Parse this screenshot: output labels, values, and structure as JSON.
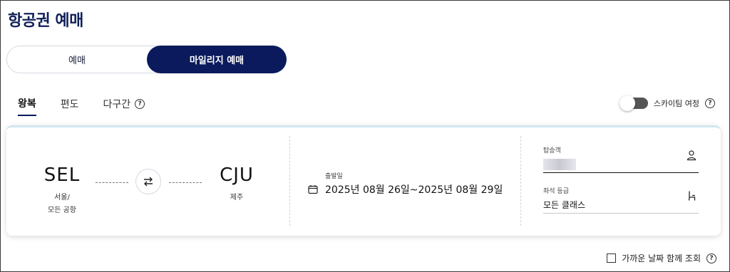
{
  "page": {
    "title": "항공권 예매"
  },
  "booking_mode": {
    "options": [
      "예매",
      "마일리지 예매"
    ],
    "selected": "마일리지 예매"
  },
  "trip_tabs": [
    {
      "label": "왕복",
      "active": true
    },
    {
      "label": "편도",
      "active": false
    },
    {
      "label": "다구간",
      "active": false
    }
  ],
  "help_glyph": "?",
  "skyrights": {
    "label": "스카이팀 여정",
    "enabled": false
  },
  "search": {
    "origin": {
      "code": "SEL",
      "city_line1": "서울/",
      "city_line2": "모든 공항"
    },
    "destination": {
      "code": "CJU",
      "city_line1": "제주"
    },
    "swap_icon": "swap-arrows-icon",
    "date": {
      "label": "출발일",
      "value": "2025년 08월 26일~2025년 08월 29일",
      "icon": "calendar-icon"
    },
    "passengers": {
      "label": "탑승객",
      "icon": "person-icon"
    },
    "cabin": {
      "label": "좌석 등급",
      "value": "모든 클래스",
      "icon": "seat-icon"
    }
  },
  "nearby_dates": {
    "label": "가까운 날짜 함께 조회",
    "checked": false
  },
  "colors": {
    "primary": "#0a1a5c",
    "card_accent": "#cfe6ef"
  }
}
